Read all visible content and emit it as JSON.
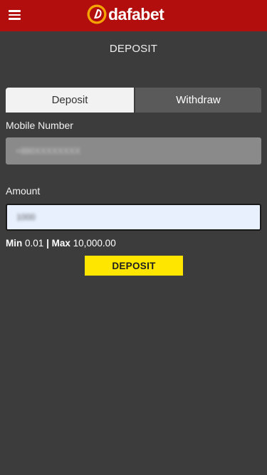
{
  "header": {
    "brand": "dafabet",
    "brand_color": "#b20e0e",
    "menu_icon": "hamburger-menu-icon",
    "logo_icon": "dafabet-logo-icon"
  },
  "page": {
    "title": "DEPOSIT"
  },
  "tabs": [
    {
      "label": "Deposit",
      "active": true
    },
    {
      "label": "Withdraw",
      "active": false
    }
  ],
  "form": {
    "mobile_label": "Mobile Number",
    "mobile_value": "+880XXXXXXXX",
    "amount_label": "Amount",
    "amount_value": "1000",
    "min_label": "Min",
    "min_value": "0.01",
    "separator": "|",
    "max_label": "Max",
    "max_value": "10,000.00",
    "submit_label": "DEPOSIT",
    "submit_color": "#ffe600"
  }
}
